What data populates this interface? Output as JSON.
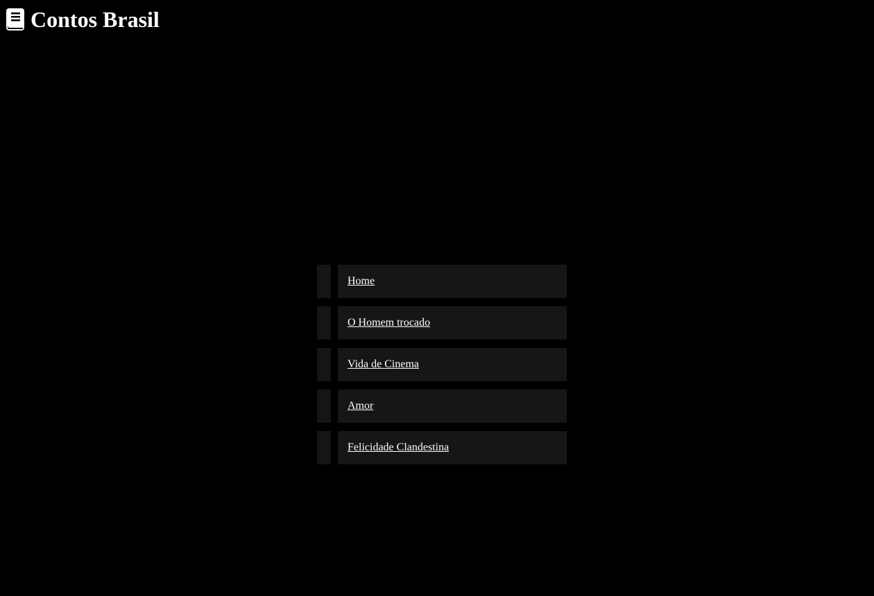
{
  "header": {
    "icon": "book-icon",
    "title": "Contos Brasil"
  },
  "colors": {
    "background": "#000000",
    "menu_box": "#161616",
    "menu_marker": "#151515",
    "text": "#ffffff"
  },
  "menu": {
    "items": [
      {
        "label": "Home"
      },
      {
        "label": "O Homem trocado"
      },
      {
        "label": "Vida de Cinema"
      },
      {
        "label": "Amor"
      },
      {
        "label": "Felicidade Clandestina"
      }
    ]
  }
}
